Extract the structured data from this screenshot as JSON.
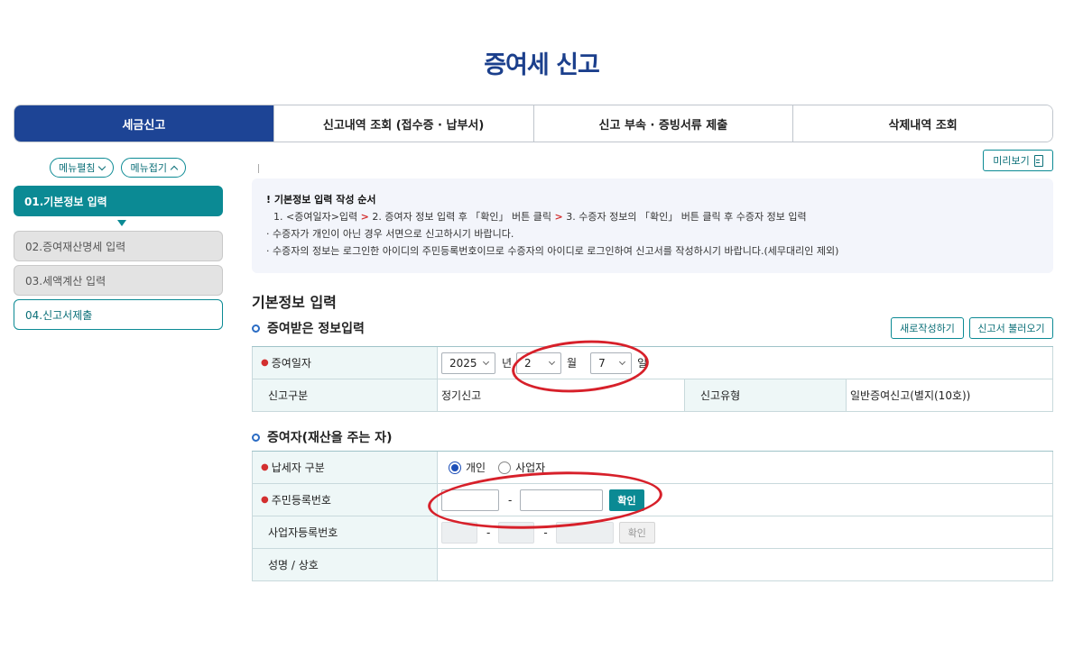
{
  "page": {
    "title": "증여세 신고"
  },
  "tabs": [
    {
      "label": "세금신고",
      "active": true
    },
    {
      "label": "신고내역 조회 (접수증 · 납부서)",
      "active": false
    },
    {
      "label": "신고 부속 · 증빙서류 제출",
      "active": false
    },
    {
      "label": "삭제내역 조회",
      "active": false
    }
  ],
  "side_menu": {
    "expand_label": "메뉴펼침",
    "collapse_label": "메뉴접기",
    "steps": [
      {
        "label": "01.기본정보 입력",
        "state": "active"
      },
      {
        "label": "02.증여재산명세 입력",
        "state": "disabled"
      },
      {
        "label": "03.세액계산 입력",
        "state": "disabled"
      },
      {
        "label": "04.신고서제출",
        "state": "outline"
      }
    ]
  },
  "toolbar": {
    "preview_label": "미리보기"
  },
  "notice": {
    "title": "! 기본정보 입력 작성 순서",
    "steps": [
      "1. <증여일자>입력",
      "2. 증여자 정보 입력 후 「확인」 버튼 클릭",
      "3. 수증자 정보의 「확인」 버튼 클릭 후 수증자 정보 입력"
    ],
    "separator": ">",
    "bullets": [
      "· 수증자가 개인이 아닌 경우 서면으로 신고하시기 바랍니다.",
      "· 수증자의 정보는 로그인한 아이디의 주민등록번호이므로 수증자의 아이디로 로그인하여 신고서를 작성하시기 바랍니다.(세무대리인 제외)"
    ]
  },
  "basic_info": {
    "heading": "기본정보 입력",
    "received_section": {
      "title": "증여받은 정보입력",
      "new_button": "새로작성하기",
      "load_button": "신고서 불러오기",
      "gift_date_label": "증여일자",
      "year_value": "2025",
      "year_unit": "년",
      "month_value": "2",
      "month_unit": "월",
      "day_value": "7",
      "day_unit": "일",
      "report_type_label": "신고구분",
      "report_type_value": "정기신고",
      "report_kind_label": "신고유형",
      "report_kind_value": "일반증여신고(별지(10호))"
    },
    "donor_section": {
      "title": "증여자(재산을 주는 자)",
      "taxpayer_type_label": "납세자 구분",
      "option_individual": "개인",
      "option_business": "사업자",
      "selected": "개인",
      "rrn_label": "주민등록번호",
      "rrn_confirm": "확인",
      "brn_label": "사업자등록번호",
      "brn_confirm": "확인",
      "dash": "-",
      "name_label": "성명 / 상호"
    }
  },
  "colors": {
    "primary": "#1d4495",
    "teal": "#0b8a94",
    "annotation_red": "#d7202a"
  }
}
